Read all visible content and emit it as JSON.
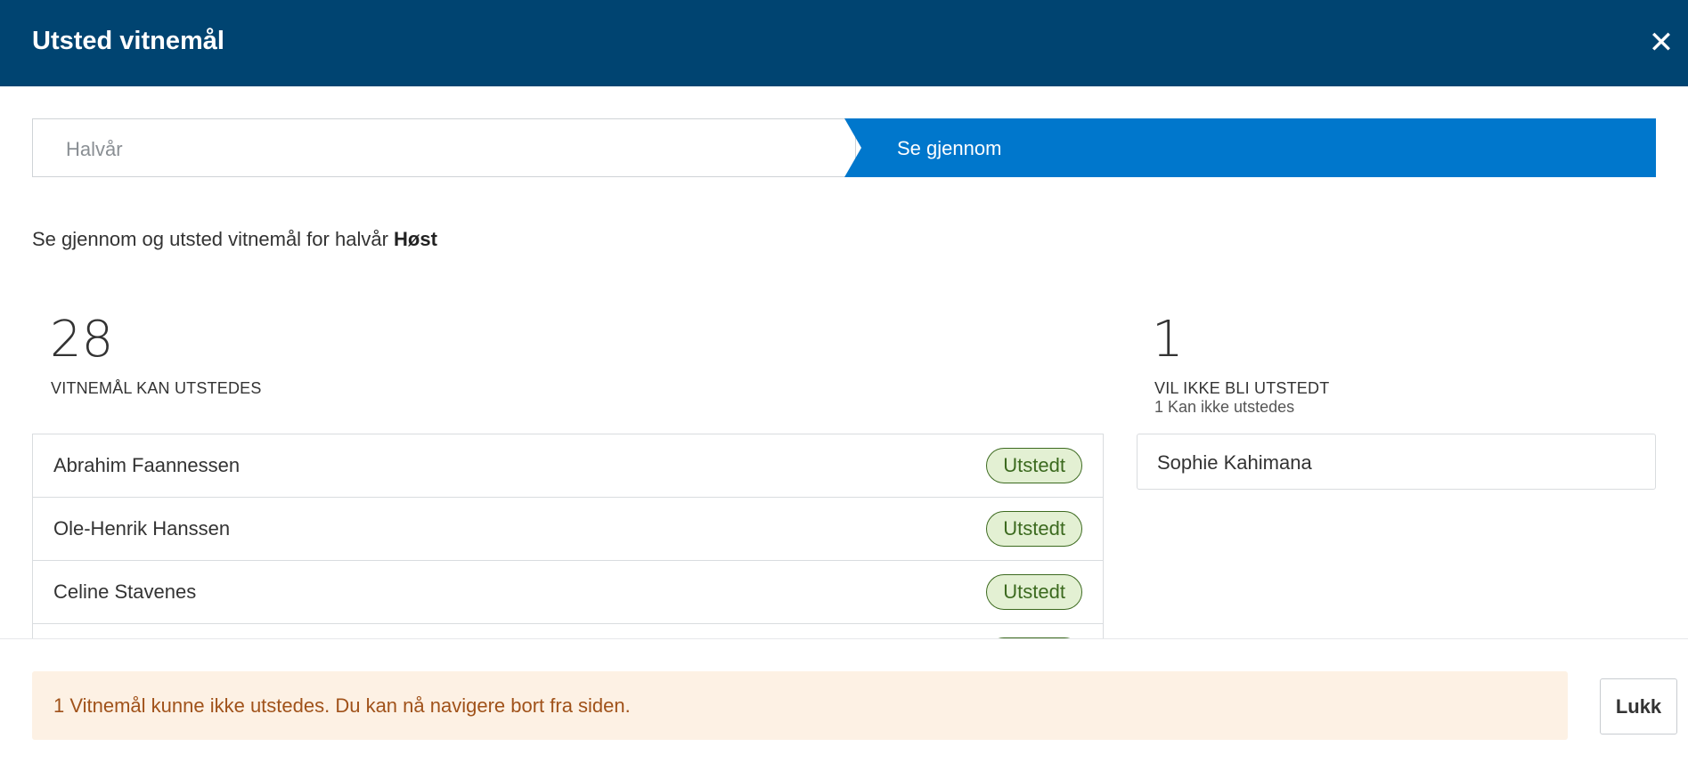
{
  "dialog": {
    "title": "Utsted vitnemål",
    "close_icon": "close-icon",
    "close_glyph": "✕"
  },
  "stepper": {
    "steps": [
      {
        "label": "Halvår",
        "state": "completed"
      },
      {
        "label": "Se gjennom",
        "state": "active"
      }
    ],
    "active_color": "#0077cc"
  },
  "intro": {
    "text": "Se gjennom og utsted vitnemål for halvår ",
    "term": "Høst"
  },
  "issuable": {
    "count": "28",
    "label": "VITNEMÅL KAN UTSTEDES",
    "students": [
      {
        "name": "Abrahim Faannessen",
        "status": "Utstedt"
      },
      {
        "name": "Ole-Henrik Hanssen",
        "status": "Utstedt"
      },
      {
        "name": "Celine Stavenes",
        "status": "Utstedt"
      }
    ]
  },
  "not_issued": {
    "count": "1",
    "label": "VIL IKKE BLI UTSTEDT",
    "sublabel": "1 Kan ikke utstedes",
    "students": [
      {
        "name": "Sophie Kahimana"
      }
    ]
  },
  "footer": {
    "alert_text": "1 Vitnemål kunne ikke utstedes. Du kan nå navigere bort fra siden.",
    "close_button": "Lukk"
  },
  "colors": {
    "header_bg": "#004471",
    "badge_bg": "#e3f0d3",
    "badge_text": "#3c6a1f",
    "alert_bg": "#fdf1e4",
    "alert_text": "#a0521a"
  }
}
